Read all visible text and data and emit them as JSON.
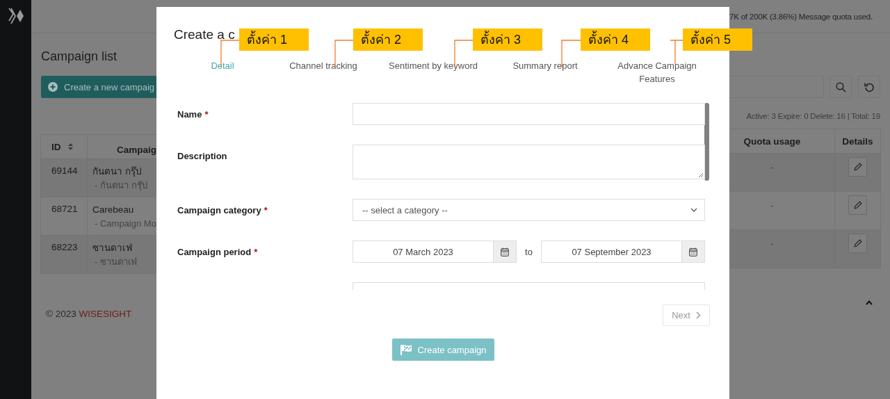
{
  "top_bar": {
    "quota": "7K of 200K (3.86%) Message quota used."
  },
  "page": {
    "title": "Campaign list",
    "create_button": "Create a new campaig",
    "summary": "Active: 3 Expire: 0 Delete: 16 | Total: 19"
  },
  "table": {
    "columns": [
      "ID",
      "Campaig",
      "Quota usage",
      "Details"
    ],
    "rows": [
      {
        "id": "69144",
        "name": "กันตนา กรุ๊ป",
        "sub": "- กันตนา กรุ๊ป",
        "quota": "-"
      },
      {
        "id": "68721",
        "name": "Carebeau",
        "sub": "- Campaign Mo",
        "quota": "-"
      },
      {
        "id": "68223",
        "name": "ซานดาเฟ่",
        "sub": "- ซานดาเฟ่",
        "quota": "-"
      }
    ]
  },
  "footer": {
    "copyright": "© 2023",
    "brand": "WISESIGHT"
  },
  "dialog": {
    "title": "Create a c",
    "steps": [
      {
        "label": "Detail",
        "selected": true
      },
      {
        "label": "Channel tracking",
        "selected": false
      },
      {
        "label": "Sentiment by keyword",
        "selected": false
      },
      {
        "label": "Summary report",
        "selected": false
      },
      {
        "label": "Advance Campaign Features",
        "selected": false
      }
    ],
    "required_mark": "*",
    "fields": [
      {
        "kind": "text",
        "label": "Name",
        "required": true
      },
      {
        "kind": "textarea",
        "label": "Description",
        "required": false
      },
      {
        "kind": "select",
        "label": "Campaign category",
        "required": true,
        "placeholder": "-- select a category --"
      },
      {
        "kind": "daterange",
        "label": "Campaign period",
        "required": true,
        "from": "07 March 2023",
        "separator": "to",
        "to": "07 September 2023"
      },
      {
        "kind": "cut"
      }
    ],
    "next_button": "Next",
    "create_button": "Create campaign"
  },
  "annotations": [
    {
      "label": "ตั้งค่า 1"
    },
    {
      "label": "ตั้งค่า 2"
    },
    {
      "label": "ตั้งค่า 3"
    },
    {
      "label": "ตั้งค่า 4"
    },
    {
      "label": "ตั้งค่า 5"
    }
  ]
}
